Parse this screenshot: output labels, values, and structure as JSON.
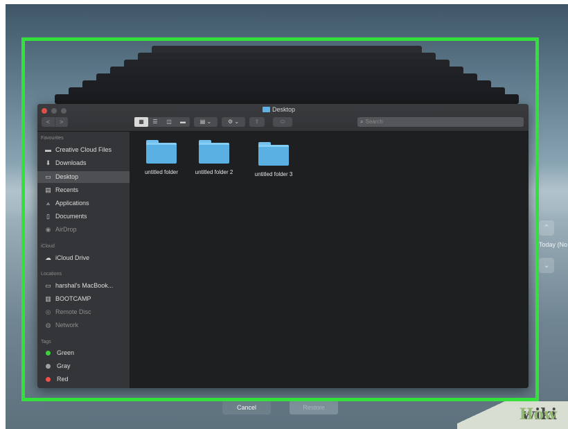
{
  "window": {
    "title": "Desktop",
    "nav": {
      "back": "<",
      "forward": ">"
    },
    "view_buttons": [
      "icon-view",
      "list-view",
      "column-view",
      "gallery-view"
    ],
    "arrange_label": "▤ ⌄",
    "action_label": "⚙ ⌄",
    "share_label": "⇪",
    "tag_label": "⬭",
    "search_placeholder": "Search"
  },
  "sidebar": {
    "favourites_header": "Favourites",
    "favourites": [
      {
        "label": "Creative Cloud Files",
        "icon": "folder-icon"
      },
      {
        "label": "Downloads",
        "icon": "download-icon"
      },
      {
        "label": "Desktop",
        "icon": "desktop-icon",
        "selected": true
      },
      {
        "label": "Recents",
        "icon": "recents-icon"
      },
      {
        "label": "Applications",
        "icon": "applications-icon"
      },
      {
        "label": "Documents",
        "icon": "documents-icon"
      },
      {
        "label": "AirDrop",
        "icon": "airdrop-icon",
        "dim": true
      }
    ],
    "icloud_header": "iCloud",
    "icloud": [
      {
        "label": "iCloud Drive",
        "icon": "cloud-icon"
      }
    ],
    "locations_header": "Locations",
    "locations": [
      {
        "label": "harshal's MacBook...",
        "icon": "laptop-icon"
      },
      {
        "label": "BOOTCAMP",
        "icon": "disk-icon"
      },
      {
        "label": "Remote Disc",
        "icon": "disc-icon",
        "dim": true
      },
      {
        "label": "Network",
        "icon": "network-icon",
        "dim": true
      }
    ],
    "tags_header": "Tags",
    "tags": [
      {
        "label": "Green",
        "color": "#3ed03e"
      },
      {
        "label": "Gray",
        "color": "#a0a0a0"
      },
      {
        "label": "Red",
        "color": "#f0504a"
      }
    ]
  },
  "content": {
    "folders": [
      "untitled folder",
      "untitled folder 2",
      "untitled folder 3"
    ]
  },
  "background": {
    "today_label": "Today (No",
    "up_arrow": "⌃",
    "down_arrow": "⌄",
    "cancel_label": "Cancel",
    "restore_label": "Restore"
  },
  "watermark": {
    "wiki": "wiki",
    "how": "How"
  },
  "colors": {
    "highlight_frame": "#34e13c",
    "folder_blue": "#5ab0e2",
    "close_button": "#e0504a"
  }
}
